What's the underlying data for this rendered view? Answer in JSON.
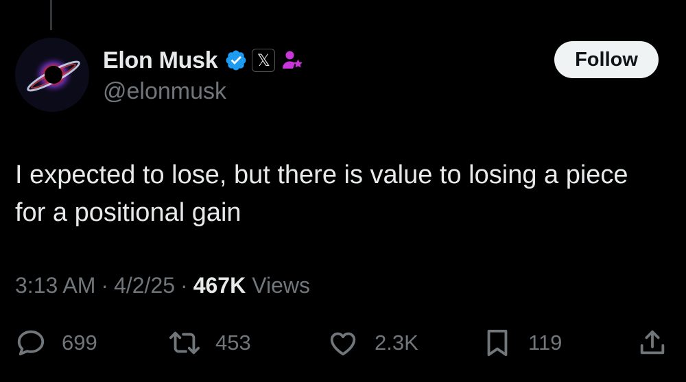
{
  "author": {
    "name": "Elon Musk",
    "handle": "@elonmusk",
    "x_badge_glyph": "𝕏",
    "verified_color": "#1d9bf0",
    "affiliate_color": "#c936d9"
  },
  "follow_button": {
    "label": "Follow"
  },
  "tweet": {
    "text": "I expected to lose, but there is value to losing a piece for a positional gain"
  },
  "meta": {
    "time": "3:13 AM",
    "separator": "·",
    "date": "4/2/25",
    "views_count": "467K",
    "views_label": "Views"
  },
  "actions": {
    "replies": {
      "icon": "reply-icon",
      "count": "699"
    },
    "reposts": {
      "icon": "repost-icon",
      "count": "453"
    },
    "likes": {
      "icon": "heart-icon",
      "count": "2.3K"
    },
    "bookmarks": {
      "icon": "bookmark-icon",
      "count": "119"
    },
    "share": {
      "icon": "share-icon"
    }
  }
}
